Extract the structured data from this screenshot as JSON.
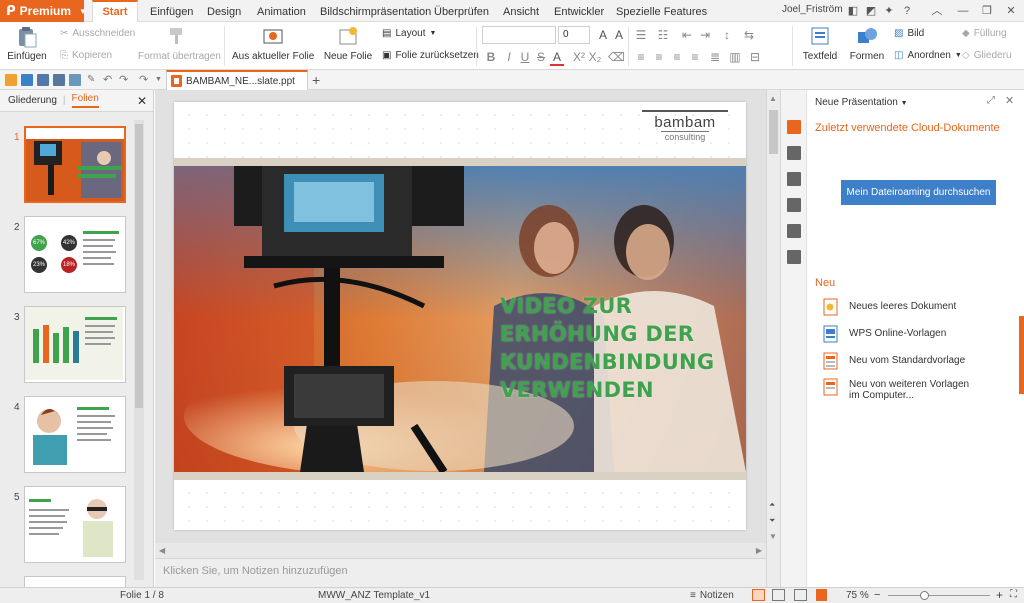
{
  "app": {
    "premium_label": "Premium",
    "active_tab": "Start",
    "tabs": [
      "Einfügen",
      "Design",
      "Animation",
      "Bildschirmpräsentation",
      "Überprüfen",
      "Ansicht",
      "Entwickler",
      "Spezielle Features"
    ],
    "user": "Joel_Friström"
  },
  "ribbon": {
    "paste": "Einfügen",
    "cut": "Ausschneiden",
    "copy": "Kopieren",
    "format_painter": "Format übertragen",
    "from_current_slide": "Aus aktueller Folie",
    "new_slide": "Neue Folie",
    "layout": "Layout",
    "reset_slide": "Folie zurücksetzen",
    "font_size": "0",
    "textbox": "Textfeld",
    "shapes": "Formen",
    "picture": "Bild",
    "arrange": "Anordnen",
    "fill": "Füllung",
    "outline": "Gliederu"
  },
  "doc": {
    "tab_title": "BAMBAM_NE...slate.ppt"
  },
  "left_panel": {
    "tab_outline": "Gliederung",
    "tab_slides": "Folien",
    "slide_numbers": [
      "1",
      "2",
      "3",
      "4",
      "5"
    ],
    "thumb2_stats": [
      "67%",
      "42%",
      "23%",
      "18%"
    ]
  },
  "slide": {
    "logo_main": "bambam",
    "logo_sub": "consulting",
    "headline": [
      "VIDEO ZUR",
      "ERHÖHUNG DER",
      "KUNDENBINDUNG",
      "VERWENDEN"
    ]
  },
  "notes": {
    "placeholder": "Klicken Sie, um Notizen hinzuzufügen"
  },
  "right_panel": {
    "title": "Neue Präsentation",
    "recent_cloud": "Zuletzt verwendete Cloud-Dokumente",
    "roaming_button": "Mein Dateiroaming durchsuchen",
    "new_heading": "Neu",
    "new_items": [
      "Neues leeres Dokument",
      "WPS Online-Vorlagen",
      "Neu vom Standardvorlage",
      "Neu von weiteren Vorlagen im Computer..."
    ]
  },
  "status": {
    "slide_counter": "Folie 1 / 8",
    "template": "MWW_ANZ Template_v1",
    "notes": "Notizen",
    "zoom": "75 %"
  },
  "colors": {
    "accent": "#e8661d",
    "headline": "#3fa34d",
    "button_blue": "#3d7fc9"
  }
}
